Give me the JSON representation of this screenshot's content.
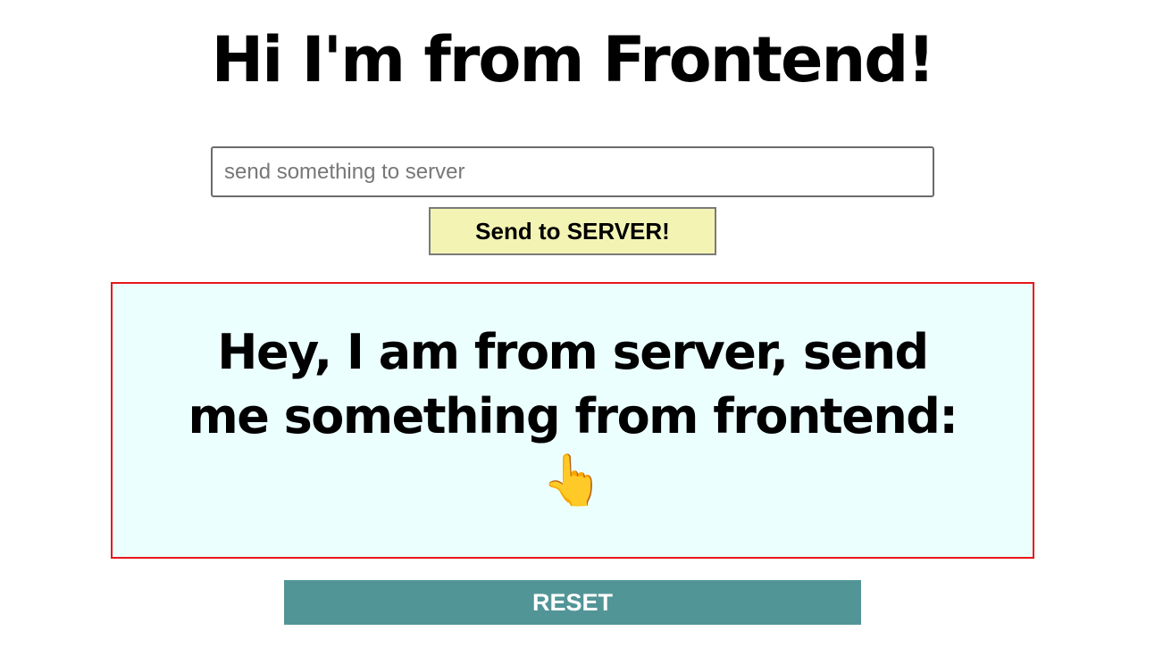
{
  "header": {
    "title": "Hi I'm from Frontend!"
  },
  "form": {
    "input_value": "",
    "input_placeholder": "send something to server",
    "send_label": "Send to SERVER!"
  },
  "server_panel": {
    "message": "Hey, I am from server, send me something from frontend:",
    "icon": "pointing-up-hand-icon",
    "icon_glyph": "👆",
    "background_color": "#ecffff",
    "border_color": "#e8161a"
  },
  "actions": {
    "reset_label": "RESET",
    "reset_color": "#529597"
  },
  "colors": {
    "send_button_bg": "#f3f4b4"
  }
}
